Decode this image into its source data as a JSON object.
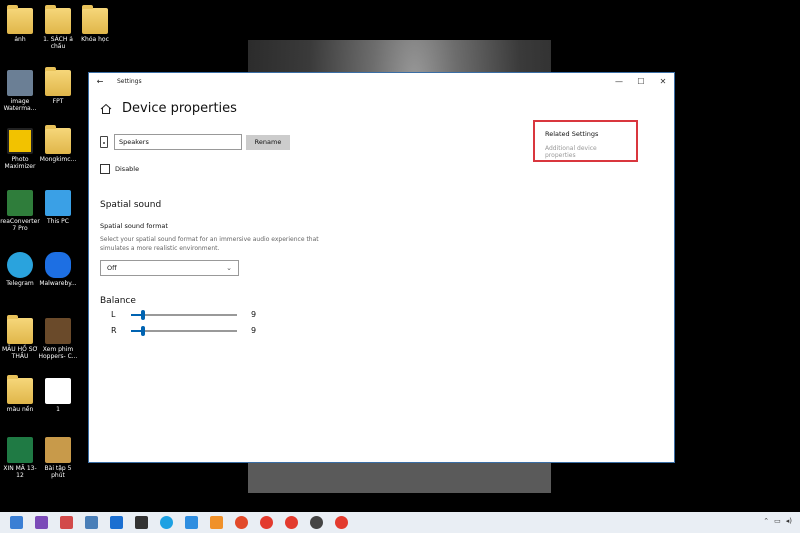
{
  "desktop": {
    "icons": [
      {
        "label": "ảnh"
      },
      {
        "label": "1. SÁCH ả chấu"
      },
      {
        "label": "Khóa học"
      },
      {
        "label": "image Waterma..."
      },
      {
        "label": "FPT"
      },
      {
        "label": "Photo Maximizer"
      },
      {
        "label": "Mongkimc..."
      },
      {
        "label": "reaConverter 7 Pro"
      },
      {
        "label": "This PC"
      },
      {
        "label": "Telegram"
      },
      {
        "label": "Malwareby..."
      },
      {
        "label": "MẪU HỒ SƠ THẦU"
      },
      {
        "label": "Xem phim Hoppers- C..."
      },
      {
        "label": "màu nền"
      },
      {
        "label": "1"
      },
      {
        "label": "XIN MÃ 13-12"
      },
      {
        "label": "Bài tập 5 phút"
      }
    ]
  },
  "window": {
    "title": "Settings",
    "page_title": "Device properties",
    "device_name": "Speakers",
    "rename_label": "Rename",
    "disable_label": "Disable",
    "spatial": {
      "section_title": "Spatial sound",
      "format_label": "Spatial sound format",
      "description": "Select your spatial sound format for an immersive audio experience that simulates a more realistic environment.",
      "selected": "Off"
    },
    "balance": {
      "section_title": "Balance",
      "left_label": "L",
      "left_value": "9",
      "right_label": "R",
      "right_value": "9"
    },
    "related": {
      "title": "Related Settings",
      "link": "Additional device properties"
    }
  },
  "colors": {
    "accent": "#0063b1",
    "highlight_box": "#d9363e"
  }
}
